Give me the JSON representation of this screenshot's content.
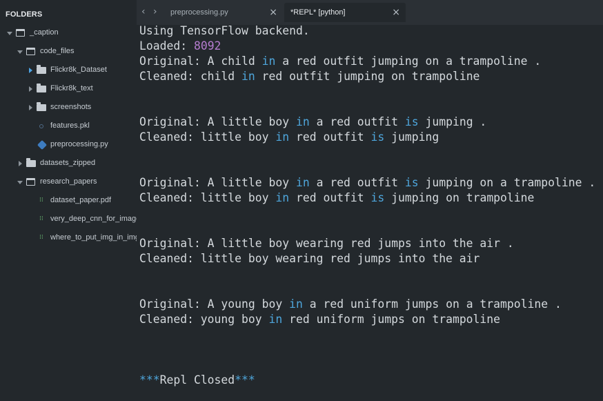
{
  "sidebar": {
    "header": "FOLDERS",
    "items": [
      {
        "label": "_caption",
        "type": "folder-open"
      },
      {
        "label": "code_files",
        "type": "folder-open"
      },
      {
        "label": "Flickr8k_Dataset",
        "type": "folder-closed"
      },
      {
        "label": "Flickr8k_text",
        "type": "folder-closed"
      },
      {
        "label": "screenshots",
        "type": "folder-closed"
      },
      {
        "label": "features.pkl",
        "type": "file",
        "icon": "pkl-file-icon"
      },
      {
        "label": "preprocessing.py",
        "type": "file",
        "icon": "python-file-icon"
      },
      {
        "label": "datasets_zipped",
        "type": "folder-closed"
      },
      {
        "label": "research_papers",
        "type": "folder-open"
      },
      {
        "label": "dataset_paper.pdf",
        "type": "file",
        "icon": "pdf-file-icon"
      },
      {
        "label": "very_deep_cnn_for_image",
        "type": "file",
        "icon": "pdf-file-icon"
      },
      {
        "label": "where_to_put_img_in_img",
        "type": "file",
        "icon": "pdf-file-icon"
      }
    ]
  },
  "tabs": {
    "back": "‹",
    "forward": "›",
    "items": [
      {
        "label": "preprocessing.py",
        "close": "×"
      },
      {
        "label": "*REPL* [python]",
        "close": "×"
      }
    ]
  },
  "repl": {
    "line1": "Using TensorFlow backend.",
    "loaded_prefix": "Loaded: ",
    "loaded_count": "8092",
    "o1": [
      "Original: A child ",
      "in",
      " a red outfit jumping on a trampoline ."
    ],
    "c1": [
      "Cleaned: child ",
      "in",
      " red outfit jumping on trampoline"
    ],
    "o2": [
      "Original: A little boy ",
      "in",
      " a red outfit ",
      "is",
      " jumping ."
    ],
    "c2": [
      "Cleaned: little boy ",
      "in",
      " red outfit ",
      "is",
      " jumping"
    ],
    "o3": [
      "Original: A little boy ",
      "in",
      " a red outfit ",
      "is",
      " jumping on a trampoline ."
    ],
    "c3": [
      "Cleaned: little boy ",
      "in",
      " red outfit ",
      "is",
      " jumping on trampoline"
    ],
    "o4": "Original: A little boy wearing red jumps into the air .",
    "c4": "Cleaned: little boy wearing red jumps into the air",
    "o5": [
      "Original: A young boy ",
      "in",
      " a red uniform jumps on a trampoline ."
    ],
    "c5": [
      "Cleaned: young boy ",
      "in",
      " red uniform jumps on trampoline"
    ],
    "closed": [
      "***",
      "Repl Closed",
      "***"
    ]
  },
  "colors": {
    "keyword": "#4ea6dc",
    "number": "#b57ccf",
    "background": "#23282c"
  }
}
